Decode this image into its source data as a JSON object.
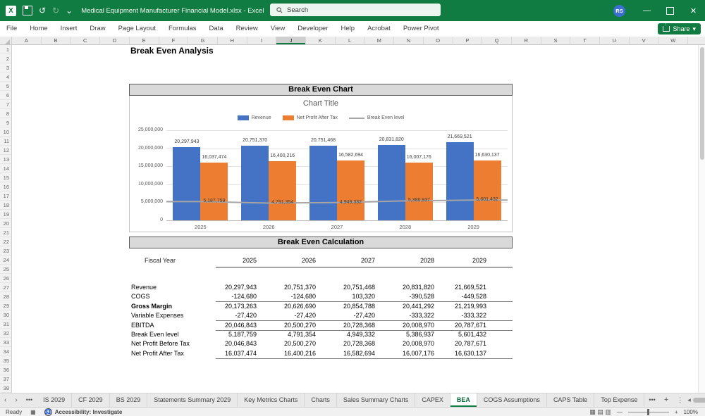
{
  "colors": {
    "titlebar": "#107C41",
    "revenue": "#4472C4",
    "net_profit": "#ED7D31",
    "break_even_line": "#A5A5A5"
  },
  "titlebar": {
    "filename": "Medical Equipment Manufacturer Financial Model.xlsx  -  Excel",
    "search_placeholder": "Search",
    "user_initials": "RS",
    "minimize": "—",
    "close": "✕",
    "undo": "↺",
    "redo": "↻",
    "qat_caret": "⌄"
  },
  "ribbon": {
    "tabs": [
      "File",
      "Home",
      "Insert",
      "Draw",
      "Page Layout",
      "Formulas",
      "Data",
      "Review",
      "View",
      "Developer",
      "Help",
      "Acrobat",
      "Power Pivot"
    ],
    "share_label": "Share",
    "share_caret": "▾"
  },
  "grid": {
    "columns": [
      "A",
      "B",
      "C",
      "D",
      "E",
      "F",
      "G",
      "H",
      "I",
      "J",
      "K",
      "L",
      "M",
      "N",
      "O",
      "P",
      "Q",
      "R",
      "S",
      "T",
      "U",
      "V",
      "W"
    ],
    "selected_column": "J",
    "row_count": 38
  },
  "sheet": {
    "title": "Break Even Analysis",
    "sections": {
      "chart_header": "Break Even Chart",
      "calc_header": "Break Even Calculation"
    },
    "table": {
      "fiscal_year_label": "Fiscal Year",
      "years": [
        "2025",
        "2026",
        "2027",
        "2028",
        "2029"
      ],
      "rows": [
        {
          "label": "Revenue",
          "bold": false,
          "underline_after": false,
          "values": [
            "20,297,943",
            "20,751,370",
            "20,751,468",
            "20,831,820",
            "21,669,521"
          ]
        },
        {
          "label": "COGS",
          "bold": false,
          "underline_after": true,
          "values": [
            "-124,680",
            "-124,680",
            "103,320",
            "-390,528",
            "-449,528"
          ]
        },
        {
          "label": "Gross Margin",
          "bold": true,
          "underline_after": false,
          "values": [
            "20,173,263",
            "20,626,690",
            "20,854,788",
            "20,441,292",
            "21,219,993"
          ]
        },
        {
          "label": "Variable Expenses",
          "bold": false,
          "underline_after": true,
          "values": [
            "-27,420",
            "-27,420",
            "-27,420",
            "-333,322",
            "-333,322"
          ]
        },
        {
          "label": "EBITDA",
          "bold": false,
          "underline_after": true,
          "values": [
            "20,046,843",
            "20,500,270",
            "20,728,368",
            "20,008,970",
            "20,787,671"
          ]
        },
        {
          "label": "Break Even level",
          "bold": false,
          "underline_after": false,
          "values": [
            "5,187,759",
            "4,791,354",
            "4,949,332",
            "5,386,937",
            "5,601,432"
          ]
        },
        {
          "label": "Net Profit Before Tax",
          "bold": false,
          "underline_after": false,
          "values": [
            "20,046,843",
            "20,500,270",
            "20,728,368",
            "20,008,970",
            "20,787,671"
          ]
        },
        {
          "label": "Net Profit After Tax",
          "bold": false,
          "underline_after": true,
          "values": [
            "16,037,474",
            "16,400,216",
            "16,582,694",
            "16,007,176",
            "16,630,137"
          ]
        }
      ]
    }
  },
  "chart_data": {
    "type": "bar",
    "title": "Chart Title",
    "categories": [
      "2025",
      "2026",
      "2027",
      "2028",
      "2029"
    ],
    "series": [
      {
        "name": "Revenue",
        "chart_type": "bar",
        "color": "#4472C4",
        "values": [
          20297943,
          20751370,
          20751468,
          20831820,
          21669521
        ],
        "labels": [
          "20,297,943",
          "20,751,370",
          "20,751,468",
          "20,831,820",
          "21,669,521"
        ]
      },
      {
        "name": "Net Profit After Tax",
        "chart_type": "bar",
        "color": "#ED7D31",
        "values": [
          16037474,
          16400216,
          16582694,
          16007176,
          16630137
        ],
        "labels": [
          "16,037,474",
          "16,400,216",
          "16,582,694",
          "16,007,176",
          "16,630,137"
        ]
      },
      {
        "name": "Break Even level",
        "chart_type": "line",
        "color": "#A5A5A5",
        "values": [
          5187759,
          4791354,
          4949332,
          5386937,
          5601432
        ],
        "labels": [
          "5,187,759",
          "4,791,354",
          "4,949,332",
          "5,386,937",
          "5,601,432"
        ]
      }
    ],
    "ylim": [
      0,
      25000000
    ],
    "ytick_labels": [
      "0",
      "5,000,000",
      "10,000,000",
      "15,000,000",
      "20,000,000",
      "25,000,000"
    ],
    "grid_on": true,
    "legend_position": "top"
  },
  "sheet_tabs": {
    "nav_left": "‹",
    "nav_right": "›",
    "overflow_left": "•••",
    "tabs": [
      "IS 2029",
      "CF 2029",
      "BS 2029",
      "Statements Summary 2029",
      "Key Metrics Charts",
      "Charts",
      "Sales Summary Charts",
      "CAPEX",
      "BEA",
      "COGS Assumptions",
      "CAPS Table",
      "Top Expense"
    ],
    "active_tab": "BEA",
    "overflow_right": "•••",
    "add_sheet": "+",
    "tab_menu": "⋮",
    "hscroll_left": "◂",
    "hscroll_right": "▸"
  },
  "status_bar": {
    "ready": "Ready",
    "macro_icon": "▦",
    "accessibility": "Accessibility: Investigate",
    "view_icons": [
      "▦",
      "▤",
      "▥"
    ],
    "zoom_minus": "—",
    "zoom_plus": "+",
    "zoom_level": "100%"
  }
}
